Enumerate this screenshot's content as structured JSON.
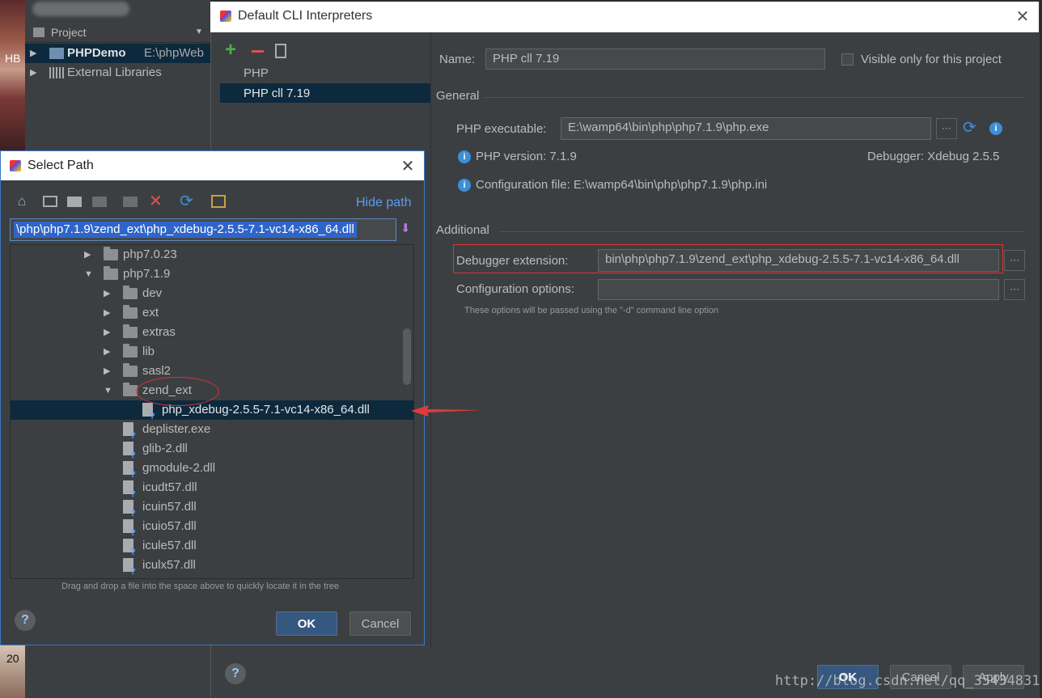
{
  "background": {
    "left_label_top": "HB",
    "left_label_bottom": "20"
  },
  "project_panel": {
    "header": "Project",
    "items": [
      {
        "label": "PHPDemo",
        "path": "E:\\phpWeb"
      },
      {
        "label": "External Libraries"
      }
    ]
  },
  "main_dialog": {
    "title": "Default CLI Interpreters",
    "interpreters": [
      "PHP",
      "PHP cll 7.19"
    ],
    "name_label": "Name:",
    "name_value": "PHP cll 7.19",
    "visible_only_label": "Visible only for this project",
    "general_label": "General",
    "php_executable_label": "PHP executable:",
    "php_executable_value": "E:\\wamp64\\bin\\php\\php7.1.9\\php.exe",
    "php_version": "PHP version: 7.1.9",
    "debugger": "Debugger: Xdebug 2.5.5",
    "config_file": "Configuration file: E:\\wamp64\\bin\\php\\php7.1.9\\php.ini",
    "additional_label": "Additional",
    "debugger_ext_label": "Debugger extension:",
    "debugger_ext_value": "bin\\php\\php7.1.9\\zend_ext\\php_xdebug-2.5.5-7.1-vc14-x86_64.dll",
    "config_options_label": "Configuration options:",
    "config_options_value": "",
    "config_hint": "These options will be passed using the \"-d\" command line option",
    "ok": "OK",
    "cancel": "Cancel",
    "apply": "Apply",
    "help": "?"
  },
  "select_path": {
    "title": "Select Path",
    "hide_path": "Hide path",
    "path_value": "\\php\\php7.1.9\\zend_ext\\php_xdebug-2.5.5-7.1-vc14-x86_64.dll",
    "tree": [
      {
        "name": "php7.0.23",
        "type": "folder",
        "depth": 0,
        "state": "collapsed"
      },
      {
        "name": "php7.1.9",
        "type": "folder",
        "depth": 0,
        "state": "expanded"
      },
      {
        "name": "dev",
        "type": "folder",
        "depth": 1,
        "state": "collapsed"
      },
      {
        "name": "ext",
        "type": "folder",
        "depth": 1,
        "state": "collapsed"
      },
      {
        "name": "extras",
        "type": "folder",
        "depth": 1,
        "state": "collapsed"
      },
      {
        "name": "lib",
        "type": "folder",
        "depth": 1,
        "state": "collapsed"
      },
      {
        "name": "sasl2",
        "type": "folder",
        "depth": 1,
        "state": "collapsed"
      },
      {
        "name": "zend_ext",
        "type": "folder",
        "depth": 1,
        "state": "expanded"
      },
      {
        "name": "php_xdebug-2.5.5-7.1-vc14-x86_64.dll",
        "type": "file",
        "depth": 2,
        "selected": true
      },
      {
        "name": "deplister.exe",
        "type": "file",
        "depth": 1
      },
      {
        "name": "glib-2.dll",
        "type": "file",
        "depth": 1
      },
      {
        "name": "gmodule-2.dll",
        "type": "file",
        "depth": 1
      },
      {
        "name": "icudt57.dll",
        "type": "file",
        "depth": 1
      },
      {
        "name": "icuin57.dll",
        "type": "file",
        "depth": 1
      },
      {
        "name": "icuio57.dll",
        "type": "file",
        "depth": 1
      },
      {
        "name": "icule57.dll",
        "type": "file",
        "depth": 1
      },
      {
        "name": "iculx57.dll",
        "type": "file",
        "depth": 1
      }
    ],
    "drag_hint": "Drag and drop a file into the space above to quickly locate it in the tree",
    "ok": "OK",
    "cancel": "Cancel",
    "help": "?"
  },
  "watermark": "http://blog.csdn.net/qq_35434831",
  "colors": {
    "background": "#2b2b2b",
    "panel": "#3c3f41",
    "selection": "#0d293e",
    "accent_blue": "#3d8fd8",
    "annotation_red": "#dd3333",
    "add_green": "#4cb04c",
    "remove_red": "#d9534f"
  }
}
